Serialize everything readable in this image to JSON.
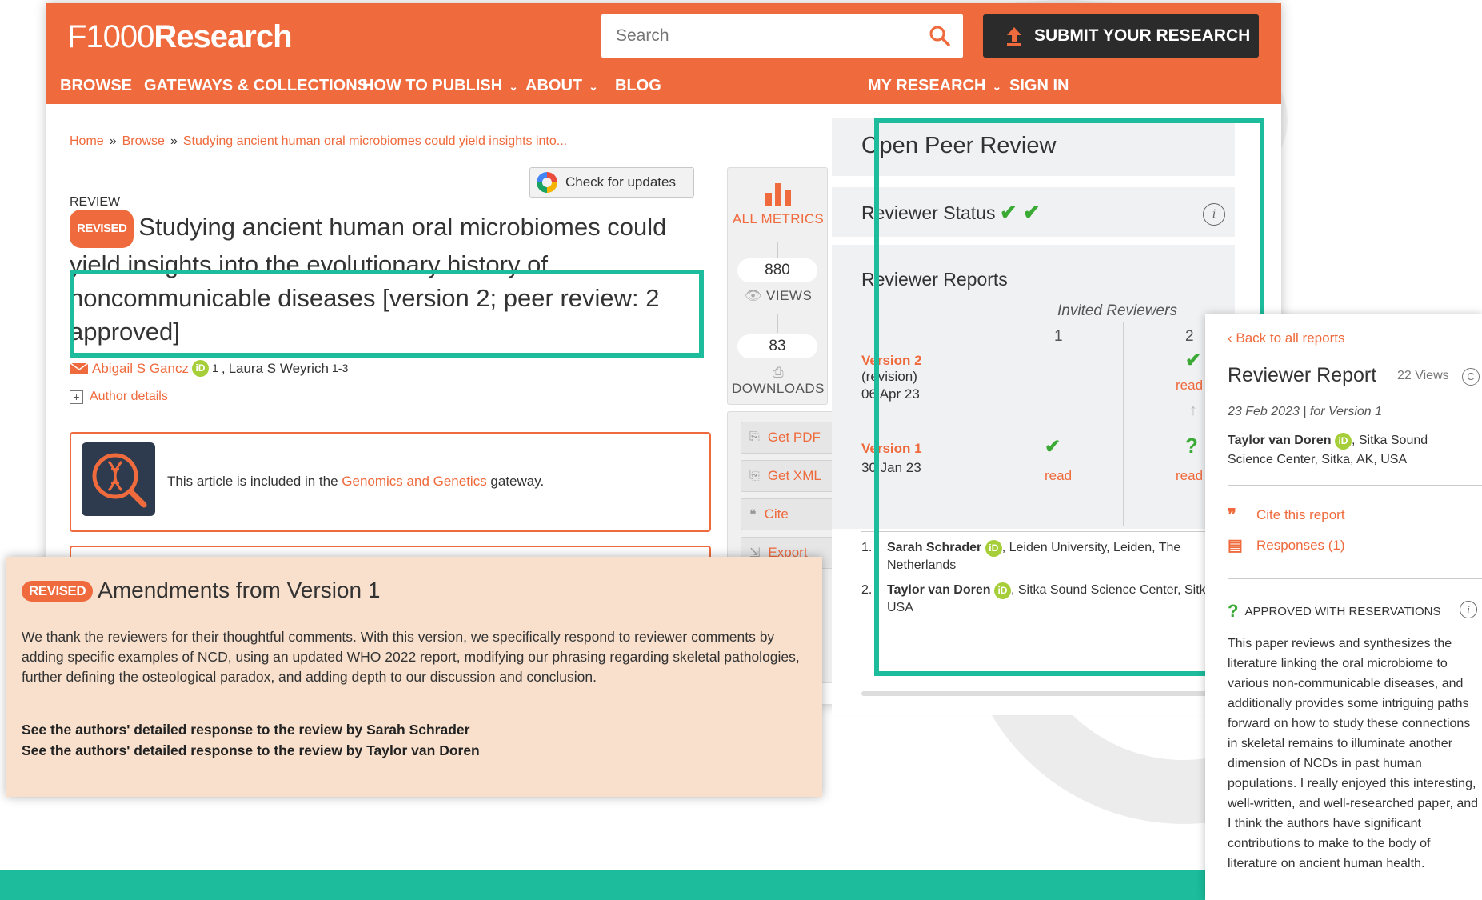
{
  "header": {
    "logo_prefix": "F1000",
    "logo_suffix": "Research",
    "search_placeholder": "Search",
    "submit_label": "SUBMIT YOUR RESEARCH",
    "nav": {
      "browse": "BROWSE",
      "gateways": "GATEWAYS & COLLECTIONS",
      "how_to_publish": "HOW TO PUBLISH",
      "about": "ABOUT",
      "blog": "BLOG",
      "my_research": "MY RESEARCH",
      "sign_in": "SIGN IN"
    }
  },
  "breadcrumb": {
    "home": "Home",
    "browse": "Browse",
    "current": "Studying ancient human oral microbiomes could yield insights into...",
    "separator": "»"
  },
  "article": {
    "check_updates": "Check for updates",
    "type": "REVIEW",
    "revised_badge": "REVISED",
    "title": "Studying ancient human oral microbiomes could yield insights into the evolutionary history of noncommunicable diseases [version 2; peer review: 2 approved]",
    "author1": "Abigail S Gancz",
    "author1_sup": "1",
    "author2": "Laura S Weyrich",
    "author2_sup": "1-3",
    "author_details": "Author details",
    "gateway_prefix": "This article is included in the ",
    "gateway_link": "Genomics and Genetics",
    "gateway_suffix": " gateway."
  },
  "metrics": {
    "all_metrics": "ALL METRICS",
    "views_count": "880",
    "views_label": "VIEWS",
    "downloads_count": "83",
    "downloads_label": "DOWNLOADS"
  },
  "actions": {
    "pdf": "Get PDF",
    "xml": "Get XML",
    "cite": "Cite",
    "export": "Export"
  },
  "peer_review": {
    "title": "Open Peer Review",
    "status_label": "Reviewer Status",
    "reports_label": "Reviewer Reports",
    "invited_label": "Invited Reviewers",
    "col1": "1",
    "col2": "2",
    "version2_label": "Version 2",
    "version2_note": "(revision)",
    "version2_date": "06 Apr 23",
    "version1_label": "Version 1",
    "version1_date": "30 Jan 23",
    "read": "read",
    "reviewers": [
      {
        "num": "1.",
        "name": "Sarah Schrader",
        "affil": ", Leiden University, Leiden, The Netherlands"
      },
      {
        "num": "2.",
        "name": "Taylor van Doren",
        "affil": ", Sitka Sound Science Center, Sitka, USA"
      }
    ]
  },
  "amendments": {
    "badge": "REVISED",
    "title": "Amendments from Version 1",
    "body": "We thank the reviewers for their thoughtful comments. With this version, we specifically respond to reviewer comments by adding specific examples of NCD, using an updated WHO 2022 report, modifying our phrasing regarding skeletal pathologies, further defining the osteological paradox, and adding depth to our discussion and conclusion.",
    "link1": "See the authors' detailed response to the review by Sarah Schrader",
    "link2": "See the authors' detailed response to the review by Taylor van Doren"
  },
  "report": {
    "back": "Back to all reports",
    "title": "Reviewer Report",
    "views": "22 Views",
    "date": "23 Feb 2023 | for Version 1",
    "author_name": "Taylor van Doren",
    "author_affil": ", Sitka Sound Science Center, Sitka, AK, USA",
    "cite": "Cite this report",
    "responses": "Responses (1)",
    "verdict": "APPROVED WITH RESERVATIONS",
    "text": "This paper reviews and synthesizes the literature linking the oral microbiome to various non-communicable diseases, and additionally provides some intriguing paths forward on how to study these connections in skeletal remains to illuminate another dimension of NCDs in past human populations. I really enjoyed this interesting, well-written, and well-researched paper, and I think the authors have significant contributions to make to the body of literature on ancient human health."
  },
  "colors": {
    "brand": "#ef6a3c",
    "highlight": "#1cbc9c",
    "approve": "#3aaa35"
  }
}
